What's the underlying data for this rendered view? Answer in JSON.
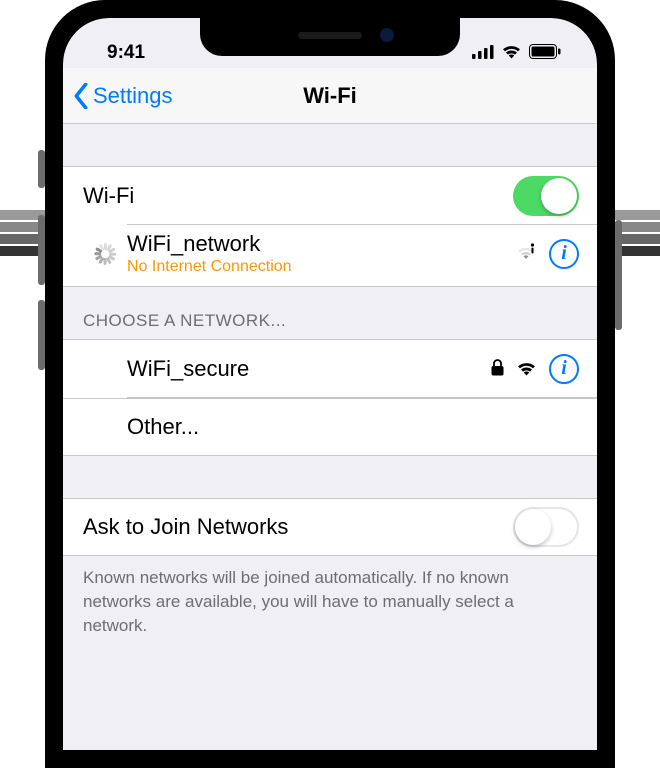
{
  "statusbar": {
    "time": "9:41"
  },
  "nav": {
    "back_label": "Settings",
    "title": "Wi-Fi"
  },
  "wifi_row": {
    "label": "Wi-Fi",
    "enabled": true
  },
  "connected": {
    "name": "WiFi_network",
    "status": "No Internet Connection"
  },
  "section_header": "CHOOSE A NETWORK...",
  "networks": [
    {
      "name": "WiFi_secure",
      "locked": true
    }
  ],
  "other_label": "Other...",
  "ask_join": {
    "label": "Ask to Join Networks",
    "enabled": false
  },
  "footer": "Known networks will be joined automatically. If no known networks are available, you will have to manually select a network."
}
